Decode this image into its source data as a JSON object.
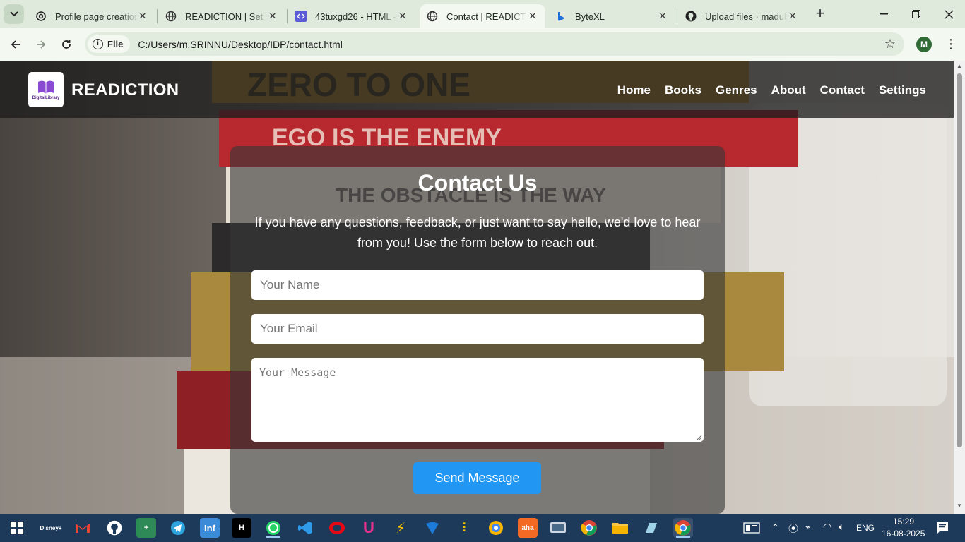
{
  "browser": {
    "tabs": [
      {
        "title": "Profile page creation",
        "icon": "openai-icon",
        "active": false
      },
      {
        "title": "READICTION | Set",
        "icon": "globe-icon",
        "active": false
      },
      {
        "title": "43tuxgd26 - HTML - C",
        "icon": "code-icon",
        "active": false
      },
      {
        "title": "Contact | READICT",
        "icon": "globe-icon",
        "active": true
      },
      {
        "title": "ByteXL",
        "icon": "bytexl-icon",
        "active": false
      },
      {
        "title": "Upload files · madubl",
        "icon": "github-icon",
        "active": false
      }
    ],
    "address": {
      "chip": "File",
      "url": "C:/Users/m.SRINNU/Desktop/IDP/contact.html"
    },
    "profile_initial": "M"
  },
  "site": {
    "brand": "READICTION",
    "logo_text": "DigitalLibrary",
    "nav": [
      "Home",
      "Books",
      "Genres",
      "About",
      "Contact",
      "Settings"
    ]
  },
  "contact": {
    "title": "Contact Us",
    "intro": "If you have any questions, feedback, or just want to say hello, we'd love to hear from you! Use the form below to reach out.",
    "name_placeholder": "Your Name",
    "email_placeholder": "Your Email",
    "message_placeholder": "Your Message",
    "send_label": "Send Message"
  },
  "taskbar": {
    "apps": [
      "hotstar",
      "gmail",
      "github",
      "app",
      "telegram",
      "infosys",
      "hackerrank",
      "whatsapp",
      "vscode",
      "app",
      "udemy",
      "app",
      "app",
      "app",
      "photos",
      "aha",
      "app",
      "chrome",
      "file-explorer",
      "app",
      "chrome-profile"
    ],
    "language": "ENG",
    "time": "15:29",
    "date": "16-08-2025"
  },
  "colors": {
    "accent": "#2196f3",
    "header": "#1e1e1e",
    "chrome": "#dfe9dc"
  }
}
